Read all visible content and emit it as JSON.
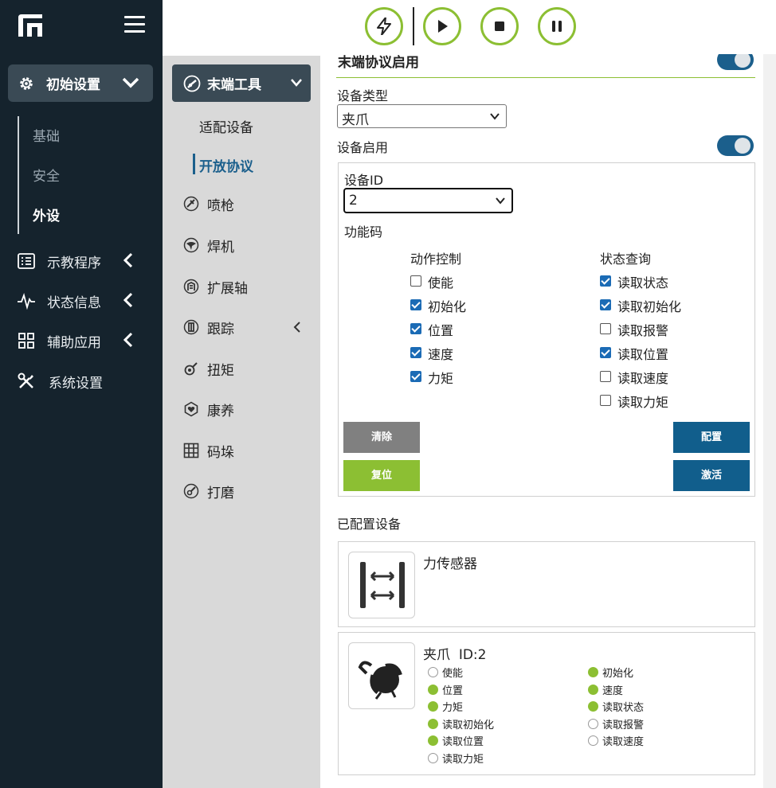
{
  "sidebar": {
    "main_label": "初始设置",
    "sub_items": [
      "基础",
      "安全",
      "外设"
    ],
    "nav_items": [
      {
        "label": "示教程序",
        "icon": "list-icon"
      },
      {
        "label": "状态信息",
        "icon": "pulse-icon"
      },
      {
        "label": "辅助应用",
        "icon": "grid-icon"
      },
      {
        "label": "系统设置",
        "icon": "tools-icon"
      }
    ]
  },
  "col2": {
    "main_label": "末端工具",
    "sub_items": [
      "适配设备",
      "开放协议"
    ],
    "items": [
      {
        "label": "喷枪",
        "icon": "spray-gun-icon"
      },
      {
        "label": "焊机",
        "icon": "welder-icon"
      },
      {
        "label": "扩展轴",
        "icon": "axis-icon"
      },
      {
        "label": "跟踪",
        "icon": "tracking-icon"
      },
      {
        "label": "扭矩",
        "icon": "torque-icon"
      },
      {
        "label": "康养",
        "icon": "care-icon"
      },
      {
        "label": "码垛",
        "icon": "palletize-icon"
      },
      {
        "label": "打磨",
        "icon": "grinding-icon"
      }
    ]
  },
  "main": {
    "header_clipped": "末端协议启用",
    "device_type_label": "设备类型",
    "device_type_value": "夹爪",
    "device_enable_label": "设备启用",
    "device_id_label": "设备ID",
    "device_id_value": "2",
    "function_code_label": "功能码",
    "action_col_title": "动作控制",
    "status_col_title": "状态查询",
    "action_items": [
      {
        "label": "使能",
        "checked": false
      },
      {
        "label": "初始化",
        "checked": true
      },
      {
        "label": "位置",
        "checked": true
      },
      {
        "label": "速度",
        "checked": true
      },
      {
        "label": "力矩",
        "checked": true
      }
    ],
    "status_items": [
      {
        "label": "读取状态",
        "checked": true
      },
      {
        "label": "读取初始化",
        "checked": true
      },
      {
        "label": "读取报警",
        "checked": false
      },
      {
        "label": "读取位置",
        "checked": true
      },
      {
        "label": "读取速度",
        "checked": false
      },
      {
        "label": "读取力矩",
        "checked": false
      }
    ],
    "buttons": {
      "clear": "清除",
      "reset": "复位",
      "config": "配置",
      "activate": "激活"
    },
    "configured_title": "已配置设备",
    "devices": [
      {
        "name": "力传感器",
        "icon": "force-sensor-icon"
      },
      {
        "name": "夹爪",
        "id_label": "ID:2",
        "icon": "gripper-icon",
        "left_stats": [
          {
            "label": "使能",
            "on": false
          },
          {
            "label": "位置",
            "on": true
          },
          {
            "label": "力矩",
            "on": true
          },
          {
            "label": "读取初始化",
            "on": true
          },
          {
            "label": "读取位置",
            "on": true
          },
          {
            "label": "读取力矩",
            "on": false
          }
        ],
        "right_stats": [
          {
            "label": "初始化",
            "on": true
          },
          {
            "label": "速度",
            "on": true
          },
          {
            "label": "读取状态",
            "on": true
          },
          {
            "label": "读取报警",
            "on": false
          },
          {
            "label": "读取速度",
            "on": false
          }
        ]
      }
    ]
  },
  "colors": {
    "accent_green": "#8cbf33",
    "accent_blue": "#115e8c",
    "sidebar_bg": "#15232d"
  }
}
